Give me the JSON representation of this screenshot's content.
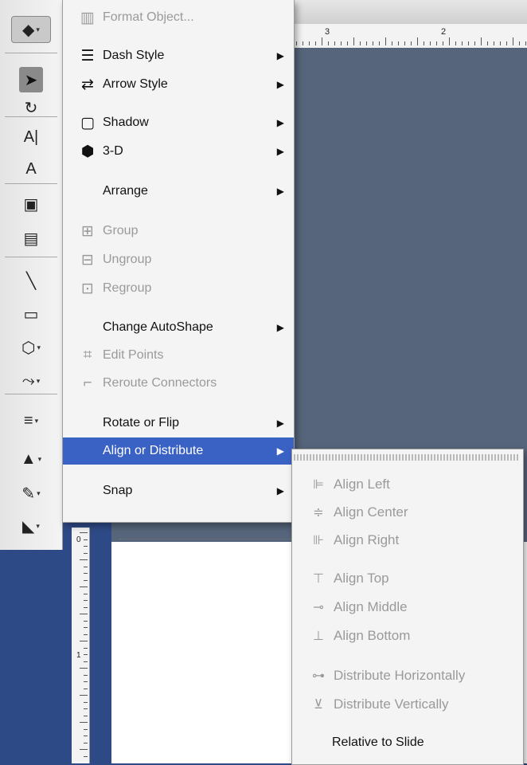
{
  "ruler": {
    "top_numbers": [
      "3",
      "2"
    ],
    "left_numbers": [
      "0",
      "1"
    ]
  },
  "toolbar": {
    "items": [
      {
        "name": "autoshape-menu-icon",
        "glyph": "◆"
      },
      {
        "name": "select-arrow-icon",
        "glyph": "➤"
      },
      {
        "name": "rotate-icon",
        "glyph": "↻"
      },
      {
        "name": "text-box-icon",
        "glyph": "A|"
      },
      {
        "name": "wordart-icon",
        "glyph": "A"
      },
      {
        "name": "clipart-icon",
        "glyph": "▣"
      },
      {
        "name": "picture-icon",
        "glyph": "▤"
      },
      {
        "name": "line-icon",
        "glyph": "╲"
      },
      {
        "name": "rectangle-icon",
        "glyph": "▭"
      },
      {
        "name": "shapes-icon",
        "glyph": "⬡"
      },
      {
        "name": "connector-icon",
        "glyph": "⤳"
      },
      {
        "name": "line-style-icon",
        "glyph": "≡"
      },
      {
        "name": "fill-color-icon",
        "glyph": "▲"
      },
      {
        "name": "line-color-icon",
        "glyph": "✎"
      },
      {
        "name": "paint-bucket-icon",
        "glyph": "◣"
      }
    ]
  },
  "menu": {
    "items": [
      {
        "label": "Format Object...",
        "icon": "format-object-icon",
        "glyph": "▥",
        "disabled": true,
        "submenu": false
      },
      {
        "label": "Dash Style",
        "icon": "dash-style-icon",
        "glyph": "☰",
        "disabled": false,
        "submenu": true
      },
      {
        "label": "Arrow Style",
        "icon": "arrow-style-icon",
        "glyph": "⇄",
        "disabled": false,
        "submenu": true
      },
      {
        "label": "Shadow",
        "icon": "shadow-icon",
        "glyph": "▢",
        "disabled": false,
        "submenu": true
      },
      {
        "label": "3-D",
        "icon": "3d-icon",
        "glyph": "⬢",
        "disabled": false,
        "submenu": true
      },
      {
        "label": "Arrange",
        "icon": "",
        "glyph": "",
        "disabled": false,
        "submenu": true
      },
      {
        "label": "Group",
        "icon": "group-icon",
        "glyph": "⊞",
        "disabled": true,
        "submenu": false
      },
      {
        "label": "Ungroup",
        "icon": "ungroup-icon",
        "glyph": "⊟",
        "disabled": true,
        "submenu": false
      },
      {
        "label": "Regroup",
        "icon": "regroup-icon",
        "glyph": "⊡",
        "disabled": true,
        "submenu": false
      },
      {
        "label": "Change AutoShape",
        "icon": "",
        "glyph": "",
        "disabled": false,
        "submenu": true
      },
      {
        "label": "Edit Points",
        "icon": "edit-points-icon",
        "glyph": "⌗",
        "disabled": true,
        "submenu": false
      },
      {
        "label": "Reroute Connectors",
        "icon": "reroute-connectors-icon",
        "glyph": "⌐",
        "disabled": true,
        "submenu": false
      },
      {
        "label": "Rotate or Flip",
        "icon": "",
        "glyph": "",
        "disabled": false,
        "submenu": true
      },
      {
        "label": "Align or Distribute",
        "icon": "",
        "glyph": "",
        "disabled": false,
        "submenu": true,
        "highlighted": true
      },
      {
        "label": "Snap",
        "icon": "",
        "glyph": "",
        "disabled": false,
        "submenu": true
      }
    ],
    "arrow": "▶"
  },
  "submenu": {
    "items": [
      {
        "label": "Align Left",
        "icon": "align-left-icon",
        "glyph": "⊫",
        "disabled": true
      },
      {
        "label": "Align Center",
        "icon": "align-center-icon",
        "glyph": "≑",
        "disabled": true
      },
      {
        "label": "Align Right",
        "icon": "align-right-icon",
        "glyph": "⊪",
        "disabled": true
      },
      {
        "label": "Align Top",
        "icon": "align-top-icon",
        "glyph": "⊤",
        "disabled": true
      },
      {
        "label": "Align Middle",
        "icon": "align-middle-icon",
        "glyph": "⊸",
        "disabled": true
      },
      {
        "label": "Align Bottom",
        "icon": "align-bottom-icon",
        "glyph": "⊥",
        "disabled": true
      },
      {
        "label": "Distribute Horizontally",
        "icon": "distribute-horizontally-icon",
        "glyph": "⊶",
        "disabled": true
      },
      {
        "label": "Distribute Vertically",
        "icon": "distribute-vertically-icon",
        "glyph": "⊻",
        "disabled": true
      },
      {
        "label": "Relative to Slide",
        "icon": "",
        "glyph": "",
        "disabled": false
      }
    ]
  },
  "colors": {
    "highlight": "#3a62c5",
    "disabled_text": "#9a9a9a",
    "workspace": "#2e4a86"
  }
}
